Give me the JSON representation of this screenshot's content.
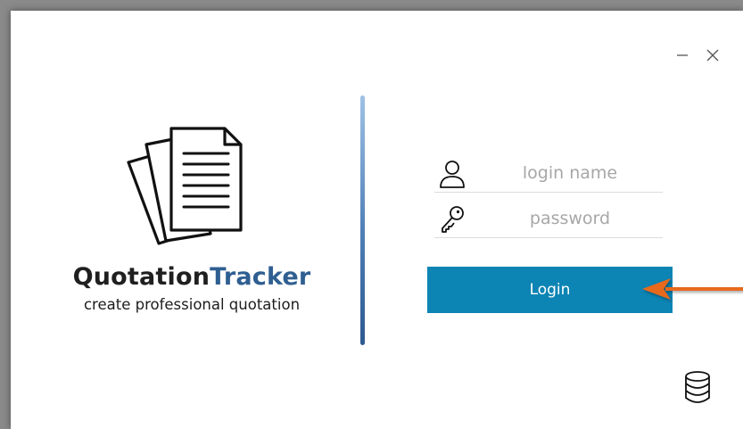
{
  "window": {
    "brand_part1": "Quotation",
    "brand_part2": "Tracker",
    "tagline": "create professional quotation"
  },
  "controls": {
    "minimize_icon": "minimize-icon",
    "close_icon": "close-icon"
  },
  "form": {
    "login_name": {
      "value": "",
      "placeholder": "login name",
      "icon": "user-icon"
    },
    "password": {
      "value": "",
      "placeholder": "password",
      "icon": "key-icon"
    },
    "login_label": "Login"
  },
  "annotation": {
    "arrow_color": "#e8691d",
    "icon": "arrow-left-icon"
  },
  "footer": {
    "icon": "database-icon"
  },
  "colors": {
    "accent": "#0c84b4",
    "brand_dark": "#1f1f1f",
    "brand_blue": "#2f5f91",
    "divider": "#4f7fb6"
  }
}
